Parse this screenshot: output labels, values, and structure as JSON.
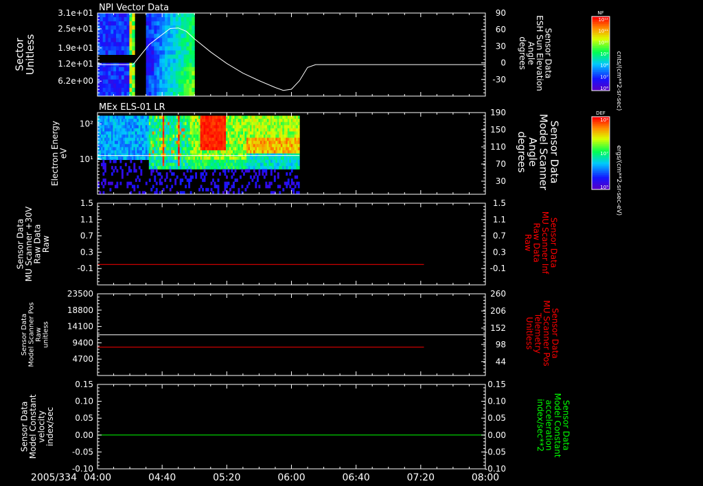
{
  "colors": {
    "background": "#000000",
    "axis": "#ffffff",
    "red_trace": "#ff0000",
    "green_trace": "#00ff00"
  },
  "time_axis": {
    "date_label": "2005/334",
    "tick_labels": [
      "04:00",
      "04:40",
      "05:20",
      "06:00",
      "06:40",
      "07:20",
      "08:00"
    ],
    "start": "04:00",
    "end": "08:00"
  },
  "chart_data": [
    {
      "type": "heatmap",
      "title": "NPI Vector Data",
      "ylabel": "Sector\nUnitless",
      "ylabel_color": "#ffffff",
      "y_tick_labels": [
        "3.1e+01",
        "2.5e+01",
        "1.9e+01",
        "1.2e+01",
        "6.2e+00"
      ],
      "data_time_ranges": [
        [
          "04:00",
          "04:23"
        ],
        [
          "04:30",
          "05:00"
        ]
      ],
      "right_axis": {
        "label": "Sensor Data\nESH Sun Elevation\nAngle\ndegrees",
        "label_color": "#ffffff",
        "tick_labels": [
          "90",
          "60",
          "30",
          "0",
          "-30"
        ],
        "ylim": [
          -55,
          90
        ]
      },
      "overlay_series": {
        "name": "Sun Elevation Angle",
        "color": "#ffffff",
        "x": [
          "04:00",
          "04:22",
          "04:32",
          "04:45",
          "04:50",
          "04:55",
          "05:00",
          "05:10",
          "05:20",
          "05:30",
          "05:40",
          "05:50",
          "05:55",
          "06:00",
          "06:05",
          "06:10",
          "06:15",
          "07:20",
          "08:00"
        ],
        "y": [
          0,
          0,
          35,
          63,
          64,
          58,
          45,
          22,
          2,
          -15,
          -28,
          -40,
          -45,
          -43,
          -28,
          -5,
          0,
          0,
          0
        ]
      },
      "colorbar": {
        "title": "NF",
        "units": "cnts/(cm**2-sr-sec)",
        "tick_labels": [
          "10¹²",
          "10¹¹",
          "10¹⁰",
          "10⁹",
          "10⁸",
          "10⁷",
          "10⁶"
        ]
      }
    },
    {
      "type": "heatmap",
      "title": "MEx ELS-01 LR",
      "ylabel": "Electron Energy\neV",
      "ylabel_color": "#ffffff",
      "y_tick_labels": [
        "10²",
        "10¹"
      ],
      "ylim_log": [
        0.3,
        2.1
      ],
      "data_time_range": [
        "04:00",
        "06:05"
      ],
      "right_axis": {
        "label": "Sensor Data\nModel Scanner\nAngle\ndegrees",
        "label_color": "#ffffff",
        "tick_labels": [
          "190",
          "150",
          "110",
          "70",
          "30"
        ],
        "ylim": [
          0,
          190
        ]
      },
      "overlay_series": {
        "name": "Scanner Angle",
        "color": "#ffffff",
        "x": [
          "04:00",
          "06:05"
        ],
        "y": [
          90,
          90
        ]
      },
      "colorbar": {
        "title": "DEF",
        "units": "ergs/(cm**2-sr-sec-eV)",
        "tick_labels": [
          "10⁹",
          "10⁷",
          "10⁵"
        ]
      }
    },
    {
      "type": "line",
      "ylabel": "Sensor Data\nMU Scanner +30V\nRaw Data\nRaw",
      "ylabel_color": "#ffffff",
      "y_tick_labels": [
        "1.5",
        "1.1",
        "0.7",
        "0.3",
        "-0.1"
      ],
      "ylim": [
        -0.5,
        1.5
      ],
      "right_axis": {
        "label": "Sensor Data\nMU Scanner Inf\nRaw Data\nRaw",
        "label_color": "#ff0000",
        "tick_labels": [
          "1.5",
          "1.1",
          "0.7",
          "0.3",
          "-0.1"
        ],
        "ylim": [
          -0.5,
          1.5
        ]
      },
      "series": [
        {
          "color": "#ff0000",
          "axis": "right",
          "x": [
            "04:00",
            "07:22"
          ],
          "y": [
            0.0,
            0.0
          ]
        }
      ]
    },
    {
      "type": "line",
      "ylabel": "Sensor Data\nModel Scanner Pos\nRaw\nunitless",
      "ylabel_color": "#ffffff",
      "y_tick_labels": [
        "23500",
        "18800",
        "14100",
        "9400",
        "4700"
      ],
      "ylim": [
        0,
        23500
      ],
      "right_axis": {
        "label": "Sensor Data\nMU Scanner Pos\nTelemetry\nUnitless",
        "label_color": "#ff0000",
        "tick_labels": [
          "260",
          "206",
          "152",
          "98",
          "44"
        ],
        "ylim": [
          0,
          260
        ]
      },
      "series": [
        {
          "color": "#ffffff",
          "axis": "left",
          "x": [
            "04:00",
            "08:00"
          ],
          "y": [
            11700,
            11700
          ]
        },
        {
          "color": "#ff0000",
          "axis": "right",
          "x": [
            "04:00",
            "07:22"
          ],
          "y": [
            90,
            90
          ]
        }
      ]
    },
    {
      "type": "line",
      "ylabel": "Sensor Data\nModel Constant\nvelocity\nindex/sec",
      "ylabel_color": "#ffffff",
      "y_tick_labels": [
        "0.15",
        "0.10",
        "0.05",
        "0.00",
        "-0.05",
        "-0.10"
      ],
      "ylim": [
        -0.1,
        0.15
      ],
      "right_axis": {
        "label": "Sensor Data\nModel Constant\nacceleration\nindex/sec**2",
        "label_color": "#00ff00",
        "tick_labels": [
          "0.15",
          "0.10",
          "0.05",
          "0.00",
          "-0.05",
          "-0.10"
        ],
        "ylim": [
          -0.1,
          0.15
        ]
      },
      "series": [
        {
          "color": "#00ff00",
          "axis": "right",
          "x": [
            "04:00",
            "08:00"
          ],
          "y": [
            0.0,
            0.0
          ]
        }
      ]
    }
  ]
}
